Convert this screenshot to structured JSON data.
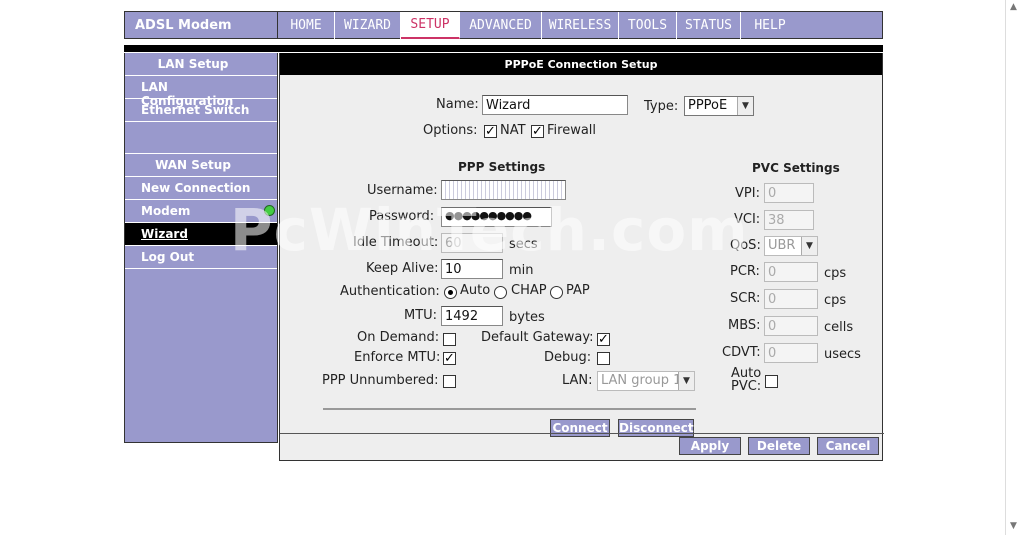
{
  "app": {
    "title": "ADSL Modem"
  },
  "nav": [
    "HOME",
    "WIZARD",
    "SETUP",
    "ADVANCED",
    "WIRELESS",
    "TOOLS",
    "STATUS",
    "HELP"
  ],
  "nav_active": "SETUP",
  "sidebar": {
    "lan_header": "LAN Setup",
    "lan_config": "LAN Configuration",
    "ethernet_switch": "Ethernet Switch",
    "wan_header": "WAN Setup",
    "new_connection": "New Connection",
    "modem": "Modem",
    "wizard": "Wizard",
    "logout": "Log Out"
  },
  "main": {
    "title": "PPPoE Connection Setup",
    "name_label": "Name:",
    "name_value": "Wizard",
    "type_label": "Type:",
    "type_value": "PPPoE",
    "options_label": "Options:",
    "nat_label": "NAT",
    "firewall_label": "Firewall",
    "ppp_settings": "PPP Settings",
    "pvc_settings": "PVC Settings",
    "username_label": "Username:",
    "password_label": "Password:",
    "password_value": "●●●●●●●●●●",
    "idle_label": "Idle Timeout:",
    "idle_value": "60",
    "idle_unit": "secs",
    "keepalive_label": "Keep Alive:",
    "keepalive_value": "10",
    "keepalive_unit": "min",
    "auth_label": "Authentication:",
    "auth_auto": "Auto",
    "auth_chap": "CHAP",
    "auth_pap": "PAP",
    "mtu_label": "MTU:",
    "mtu_value": "1492",
    "mtu_unit": "bytes",
    "ondemand_label": "On Demand:",
    "defgw_label": "Default Gateway:",
    "enforcemtu_label": "Enforce MTU:",
    "debug_label": "Debug:",
    "unnumbered_label": "PPP Unnumbered:",
    "lan_label": "LAN:",
    "lan_value": "LAN group 1",
    "vpi_label": "VPI:",
    "vpi_value": "0",
    "vci_label": "VCI:",
    "vci_value": "38",
    "qos_label": "QoS:",
    "qos_value": "UBR",
    "pcr_label": "PCR:",
    "pcr_value": "0",
    "pcr_unit": "cps",
    "scr_label": "SCR:",
    "scr_value": "0",
    "scr_unit": "cps",
    "mbs_label": "MBS:",
    "mbs_value": "0",
    "mbs_unit": "cells",
    "cdvt_label": "CDVT:",
    "cdvt_value": "0",
    "cdvt_unit": "usecs",
    "autopvc_line1": "Auto",
    "autopvc_line2": "PVC:",
    "connect": "Connect",
    "disconnect": "Disconnect",
    "apply": "Apply",
    "delete": "Delete",
    "cancel": "Cancel"
  },
  "watermark": "PcWinTech.com",
  "colors": {
    "accent": "#9999cc",
    "active_tab": "#cc3366",
    "status_ok": "#44cc44"
  }
}
